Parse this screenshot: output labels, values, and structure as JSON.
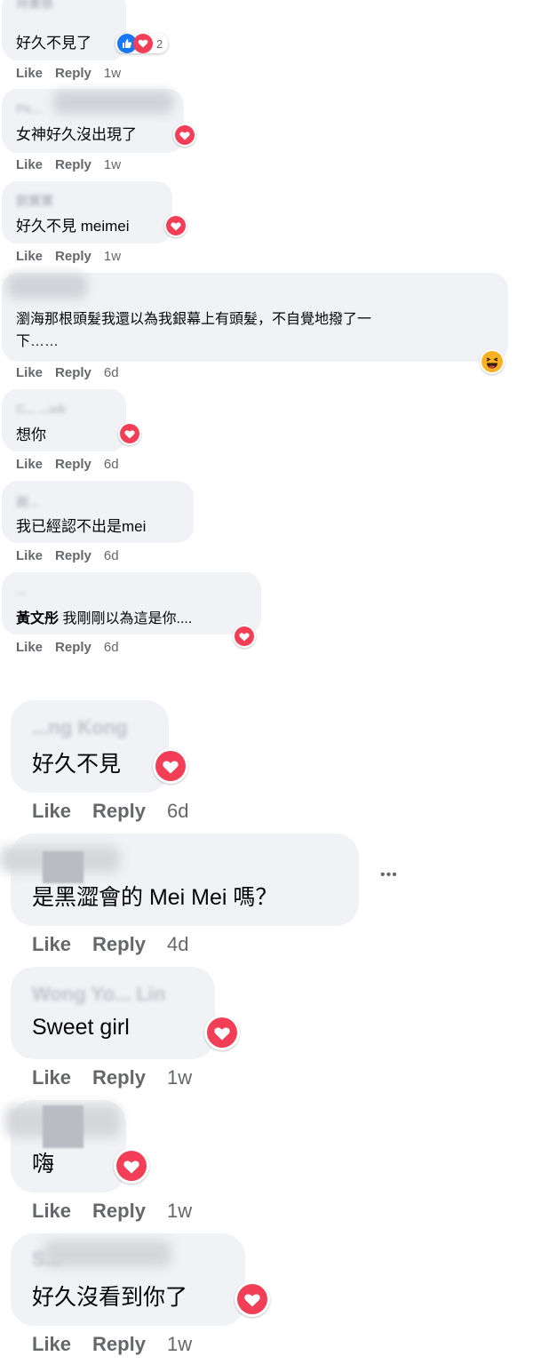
{
  "comments": [
    {
      "author": "林寶慈",
      "text": "好久不見了",
      "actions": {
        "like": "Like",
        "reply": "Reply",
        "time": "1w"
      },
      "reactions": [
        "like-icon",
        "love-icon"
      ],
      "reaction_count": "2"
    },
    {
      "author": "Pe...",
      "text": "女神好久沒出現了",
      "actions": {
        "like": "Like",
        "reply": "Reply",
        "time": "1w"
      },
      "reactions": [
        "love-icon"
      ]
    },
    {
      "author": "劉寶寶",
      "text": "好久不見 meimei",
      "actions": {
        "like": "Like",
        "reply": "Reply",
        "time": "1w"
      },
      "reactions": [
        "love-icon"
      ]
    },
    {
      "author": "",
      "text_line1": "瀏海那根頭髮我還以為我銀幕上有頭髮，不自覺地撥了一",
      "text_line2": "下……",
      "actions": {
        "like": "Like",
        "reply": "Reply",
        "time": "6d"
      },
      "reactions": [
        "haha-icon"
      ]
    },
    {
      "author": "C... ...wk",
      "text": "想你",
      "actions": {
        "like": "Like",
        "reply": "Reply",
        "time": "6d"
      },
      "reactions": [
        "love-icon"
      ]
    },
    {
      "author": "謝...",
      "text": "我已經認不出是mei",
      "actions": {
        "like": "Like",
        "reply": "Reply",
        "time": "6d"
      }
    },
    {
      "author": "...",
      "mention": "黃文彤",
      "text": " 我剛剛以為這是你....",
      "actions": {
        "like": "Like",
        "reply": "Reply",
        "time": "6d"
      },
      "reactions": [
        "love-icon"
      ]
    },
    {
      "author": "...ng Kong",
      "text": "好久不見",
      "actions": {
        "like": "Like",
        "reply": "Reply",
        "time": "6d"
      },
      "reactions": [
        "love-icon"
      ]
    },
    {
      "author": "",
      "text": "是黑澀會的 Mei Mei 嗎？",
      "actions": {
        "like": "Like",
        "reply": "Reply",
        "time": "4d"
      },
      "more": "•••"
    },
    {
      "author": "Wong Yo... Lin",
      "text": "Sweet girl",
      "actions": {
        "like": "Like",
        "reply": "Reply",
        "time": "1w"
      },
      "reactions": [
        "love-icon"
      ]
    },
    {
      "author": "",
      "text": "嗨",
      "actions": {
        "like": "Like",
        "reply": "Reply",
        "time": "1w"
      },
      "reactions": [
        "love-icon"
      ]
    },
    {
      "author": "S...",
      "text": "好久沒看到你了",
      "actions": {
        "like": "Like",
        "reply": "Reply",
        "time": "1w"
      },
      "reactions": [
        "love-icon"
      ]
    }
  ],
  "colors": {
    "bubble": "#f0f2f5",
    "meta": "#65676b",
    "like": "#1877f2",
    "love": "#f33e58",
    "haha": "#f7b125"
  }
}
